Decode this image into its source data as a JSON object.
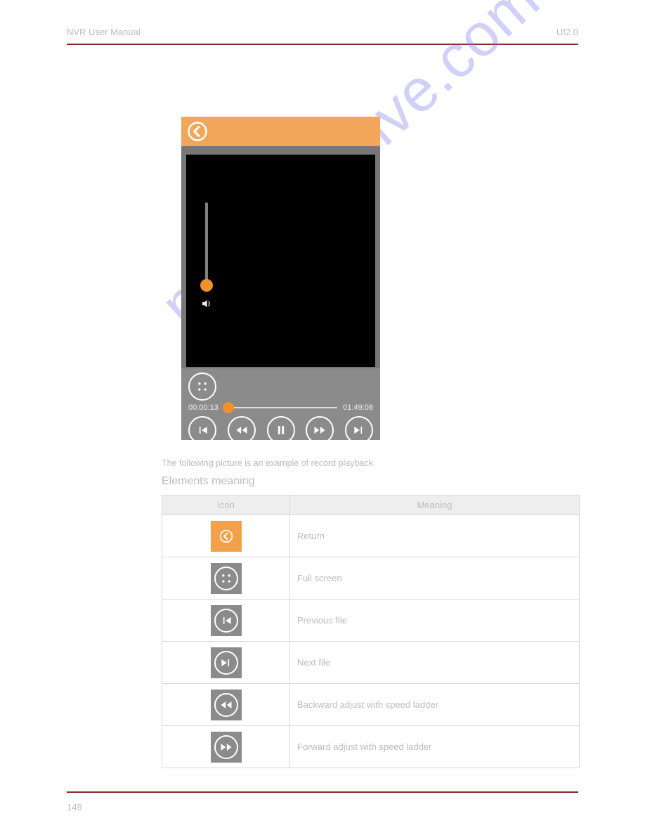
{
  "header": {
    "left": "NVR User Manual",
    "right": "UI2.0"
  },
  "footer": {
    "page": "149"
  },
  "watermark": "manualsmve.com",
  "player": {
    "time_current": "00:00:13",
    "time_total": "01:49:08"
  },
  "after_player_note": "The following picture is an example of record playback.",
  "elements": {
    "heading": "Elements meaning",
    "columns": {
      "icon": "Icon",
      "meaning": "Meaning"
    },
    "rows": [
      {
        "meaning": "Return"
      },
      {
        "meaning": "Full screen"
      },
      {
        "meaning": "Previous file"
      },
      {
        "meaning": "Next file"
      },
      {
        "meaning": "Backward adjust with speed ladder"
      },
      {
        "meaning": "Forward adjust with speed ladder"
      }
    ]
  }
}
